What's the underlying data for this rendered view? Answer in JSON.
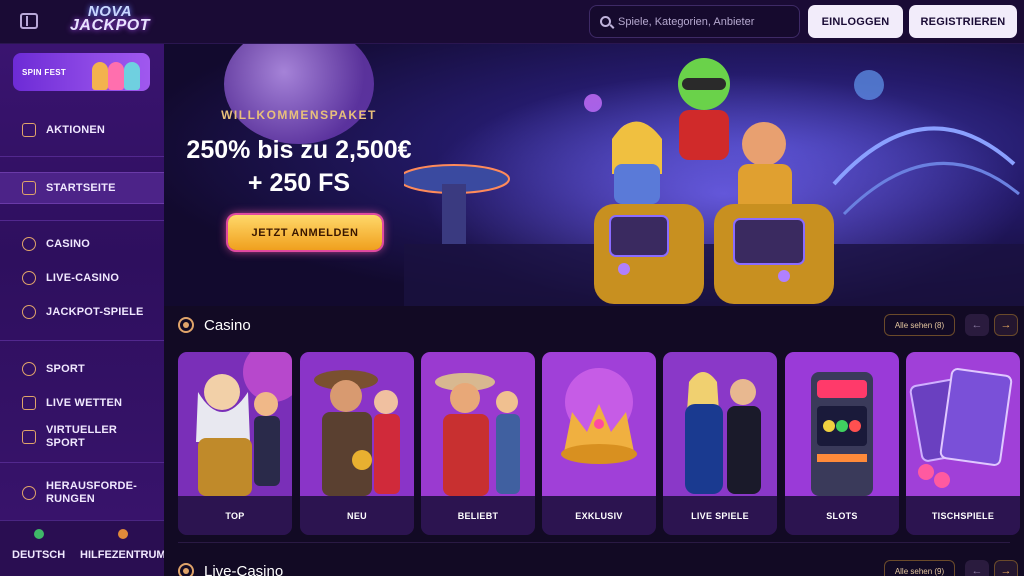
{
  "header": {
    "logo_line1": "NOVA",
    "logo_line2": "JACKPOT",
    "search_placeholder": "Spiele, Kategorien, Anbieter",
    "login_label": "EINLOGGEN",
    "register_label": "REGISTRIEREN"
  },
  "sidebar": {
    "promo_label": "SPIN FEST",
    "items": [
      {
        "label": "AKTIONEN",
        "icon": "gift-icon"
      },
      {
        "label": "STARTSEITE",
        "icon": "home-icon",
        "active": true
      },
      {
        "label": "CASINO",
        "icon": "chip-icon"
      },
      {
        "label": "LIVE-CASINO",
        "icon": "spade-icon"
      },
      {
        "label": "JACKPOT-SPIELE",
        "icon": "seven-icon"
      },
      {
        "label": "SPORT",
        "icon": "ball-icon"
      },
      {
        "label": "LIVE WETTEN",
        "icon": "live-icon"
      },
      {
        "label": "VIRTUELLER SPORT",
        "label_line1": "VIRTUELLER",
        "label_line2": "SPORT",
        "icon": "gamepad-icon"
      },
      {
        "label": "HERAUSFORDERUNGEN",
        "label_line1": "HERAUSFORDE-",
        "label_line2": "RUNGEN",
        "icon": "medal-icon"
      }
    ],
    "language_label": "DEUTSCH",
    "help_label": "HILFEZENTRUM"
  },
  "hero": {
    "kicker": "WILLKOMMENSPAKET",
    "headline_line1": "250% bis zu 2,500€",
    "headline_line2": "+ 250 FS",
    "cta_label": "JETZT ANMELDEN"
  },
  "sections": [
    {
      "title": "Casino",
      "see_all_label": "Alle sehen (8)",
      "cards": [
        {
          "label": "TOP"
        },
        {
          "label": "NEU"
        },
        {
          "label": "BELIEBT"
        },
        {
          "label": "EXKLUSIV"
        },
        {
          "label": "LIVE SPIELE"
        },
        {
          "label": "SLOTS"
        },
        {
          "label": "TISCHSPIELE"
        }
      ]
    },
    {
      "title": "Live-Casino",
      "see_all_label": "Alle sehen (9)"
    }
  ],
  "colors": {
    "accent_gold": "#f0a01e",
    "sidebar_bg": "#3a1470",
    "topbar_bg": "#1a0b35"
  }
}
